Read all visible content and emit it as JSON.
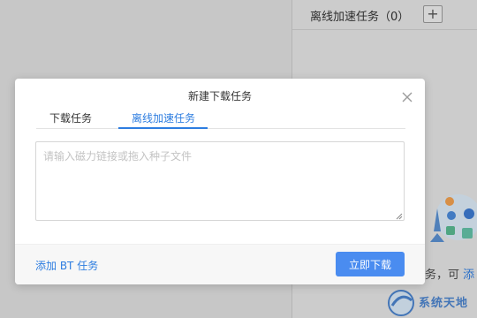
{
  "background": {
    "right_panel_title": "离线加速任务（0）",
    "add_button_label": "+",
    "hint_text": "务，可",
    "hint_link": "添",
    "watermark_text": "系统天地"
  },
  "dialog": {
    "title": "新建下载任务",
    "tabs": [
      {
        "label": "下载任务",
        "active": false
      },
      {
        "label": "离线加速任务",
        "active": true
      }
    ],
    "input": {
      "value": "",
      "placeholder": "请输入磁力链接或拖入种子文件"
    },
    "add_bt_label": "添加 BT 任务",
    "download_button_label": "立即下载"
  },
  "colors": {
    "accent": "#2d7de0",
    "primary_button": "#4a8cf0",
    "overlay": "rgba(0,0,0,0.10)"
  }
}
